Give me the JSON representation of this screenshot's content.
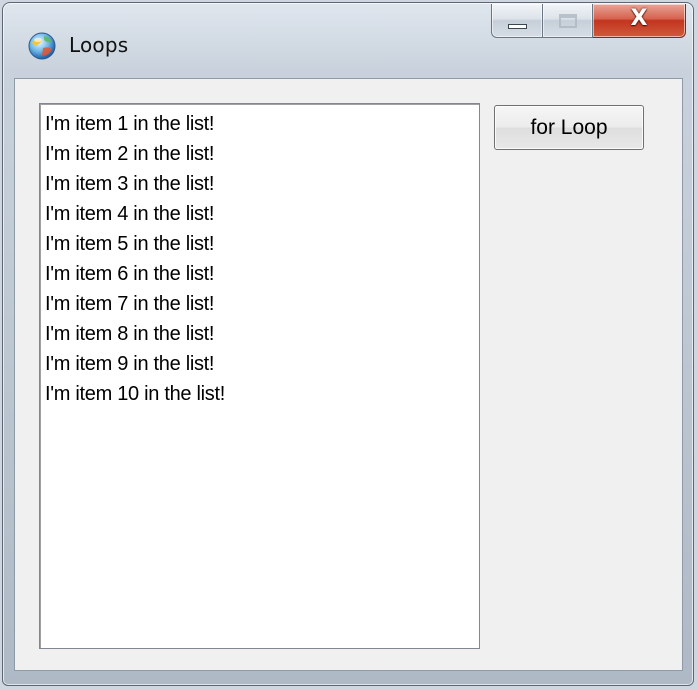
{
  "window": {
    "title": "Loops",
    "icon": "app-globe-icon",
    "caption_buttons": {
      "minimize": "minimize-icon",
      "maximize": "maximize-icon",
      "close": "X"
    }
  },
  "listbox": {
    "items": [
      "I'm item 1 in the list!",
      "I'm item 2 in the list!",
      "I'm item 3 in the list!",
      "I'm item 4 in the list!",
      "I'm item 5 in the list!",
      "I'm item 6 in the list!",
      "I'm item 7 in the list!",
      "I'm item 8 in the list!",
      "I'm item 9 in the list!",
      "I'm item 10 in the list!"
    ]
  },
  "buttons": {
    "for_loop": "for Loop"
  },
  "colors": {
    "close_button": "#c2351e",
    "client_background": "#f0f0f0",
    "list_background": "#ffffff"
  }
}
